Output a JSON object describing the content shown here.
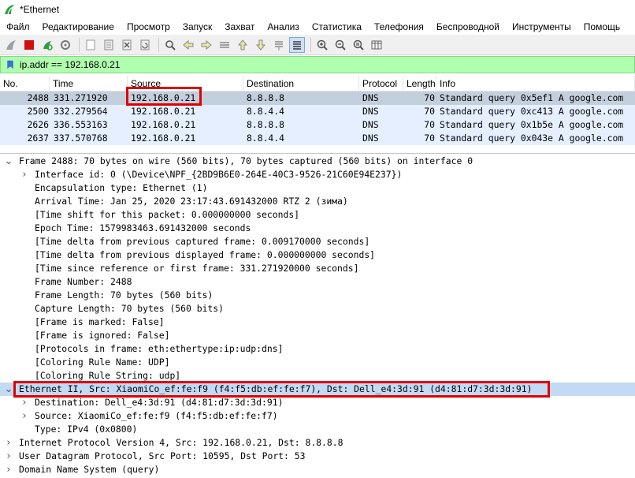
{
  "window": {
    "title": "*Ethernet"
  },
  "menu": [
    "Файл",
    "Редактирование",
    "Просмотр",
    "Запуск",
    "Захват",
    "Анализ",
    "Статистика",
    "Телефония",
    "Беспроводной",
    "Инструменты",
    "Помощь"
  ],
  "toolbar": {
    "icons": [
      "shark-fin-icon",
      "stop-icon",
      "restart-icon",
      "options-gear-icon",
      "open-file-icon",
      "save-file-icon",
      "close-file-icon",
      "reload-icon",
      "find-icon",
      "back-arrow-icon",
      "forward-arrow-icon",
      "goto-packet-icon",
      "first-packet-icon",
      "last-packet-icon",
      "autoscroll-icon",
      "colorize-icon",
      "zoom-in-icon",
      "zoom-out-icon",
      "normal-size-icon",
      "resize-columns-icon"
    ]
  },
  "filter": {
    "value": "ip.addr == 192.168.0.21"
  },
  "packet_list": {
    "columns": [
      "No.",
      "Time",
      "Source",
      "Destination",
      "Protocol",
      "Length",
      "Info"
    ],
    "rows": [
      {
        "no": "2488",
        "time": "331.271920",
        "source": "192.168.0.21",
        "destination": "8.8.8.8",
        "protocol": "DNS",
        "length": "70",
        "info": "Standard query 0x5ef1 A google.com"
      },
      {
        "no": "2500",
        "time": "332.279564",
        "source": "192.168.0.21",
        "destination": "8.8.4.4",
        "protocol": "DNS",
        "length": "70",
        "info": "Standard query 0xc413 A google.com"
      },
      {
        "no": "2626",
        "time": "336.553163",
        "source": "192.168.0.21",
        "destination": "8.8.8.8",
        "protocol": "DNS",
        "length": "70",
        "info": "Standard query 0x1b5e A google.com"
      },
      {
        "no": "2637",
        "time": "337.570768",
        "source": "192.168.0.21",
        "destination": "8.8.4.4",
        "protocol": "DNS",
        "length": "70",
        "info": "Standard query 0x043e A google.com"
      }
    ]
  },
  "details": {
    "lines": [
      {
        "text": "Frame 2488: 70 bytes on wire (560 bits), 70 bytes captured (560 bits) on interface 0",
        "indent": 0,
        "chevron": "down"
      },
      {
        "text": "Interface id: 0 (\\Device\\NPF_{2BD9B6E0-264E-40C3-9526-21C60E94E237})",
        "indent": 1,
        "chevron": "right"
      },
      {
        "text": "Encapsulation type: Ethernet (1)",
        "indent": 1,
        "chevron": ""
      },
      {
        "text": "Arrival Time: Jan 25, 2020 23:17:43.691432000 RTZ 2 (зима)",
        "indent": 1,
        "chevron": ""
      },
      {
        "text": "[Time shift for this packet: 0.000000000 seconds]",
        "indent": 1,
        "chevron": ""
      },
      {
        "text": "Epoch Time: 1579983463.691432000 seconds",
        "indent": 1,
        "chevron": ""
      },
      {
        "text": "[Time delta from previous captured frame: 0.009170000 seconds]",
        "indent": 1,
        "chevron": ""
      },
      {
        "text": "[Time delta from previous displayed frame: 0.000000000 seconds]",
        "indent": 1,
        "chevron": ""
      },
      {
        "text": "[Time since reference or first frame: 331.271920000 seconds]",
        "indent": 1,
        "chevron": ""
      },
      {
        "text": "Frame Number: 2488",
        "indent": 1,
        "chevron": ""
      },
      {
        "text": "Frame Length: 70 bytes (560 bits)",
        "indent": 1,
        "chevron": ""
      },
      {
        "text": "Capture Length: 70 bytes (560 bits)",
        "indent": 1,
        "chevron": ""
      },
      {
        "text": "[Frame is marked: False]",
        "indent": 1,
        "chevron": ""
      },
      {
        "text": "[Frame is ignored: False]",
        "indent": 1,
        "chevron": ""
      },
      {
        "text": "[Protocols in frame: eth:ethertype:ip:udp:dns]",
        "indent": 1,
        "chevron": ""
      },
      {
        "text": "[Coloring Rule Name: UDP]",
        "indent": 1,
        "chevron": ""
      },
      {
        "text": "[Coloring Rule String: udp]",
        "indent": 1,
        "chevron": ""
      },
      {
        "text": "Ethernet II, Src: XiaomiCo_ef:fe:f9 (f4:f5:db:ef:fe:f7), Dst: Dell_e4:3d:91 (d4:81:d7:3d:3d:91)",
        "indent": 0,
        "chevron": "down"
      },
      {
        "text": "Destination: Dell_e4:3d:91 (d4:81:d7:3d:3d:91)",
        "indent": 1,
        "chevron": "right"
      },
      {
        "text": "Source: XiaomiCo_ef:fe:f9 (f4:f5:db:ef:fe:f7)",
        "indent": 1,
        "chevron": "right"
      },
      {
        "text": "Type: IPv4 (0x0800)",
        "indent": 1,
        "chevron": ""
      },
      {
        "text": "Internet Protocol Version 4, Src: 192.168.0.21, Dst: 8.8.8.8",
        "indent": 0,
        "chevron": "right"
      },
      {
        "text": "User Datagram Protocol, Src Port: 10595, Dst Port: 53",
        "indent": 0,
        "chevron": "right"
      },
      {
        "text": "Domain Name System (query)",
        "indent": 0,
        "chevron": "right"
      }
    ]
  },
  "colors": {
    "filter_bg": "#afffaf",
    "row_bg": "#e5efff",
    "row_selected": "#c3cfdd",
    "highlight_box": "#e00000"
  }
}
